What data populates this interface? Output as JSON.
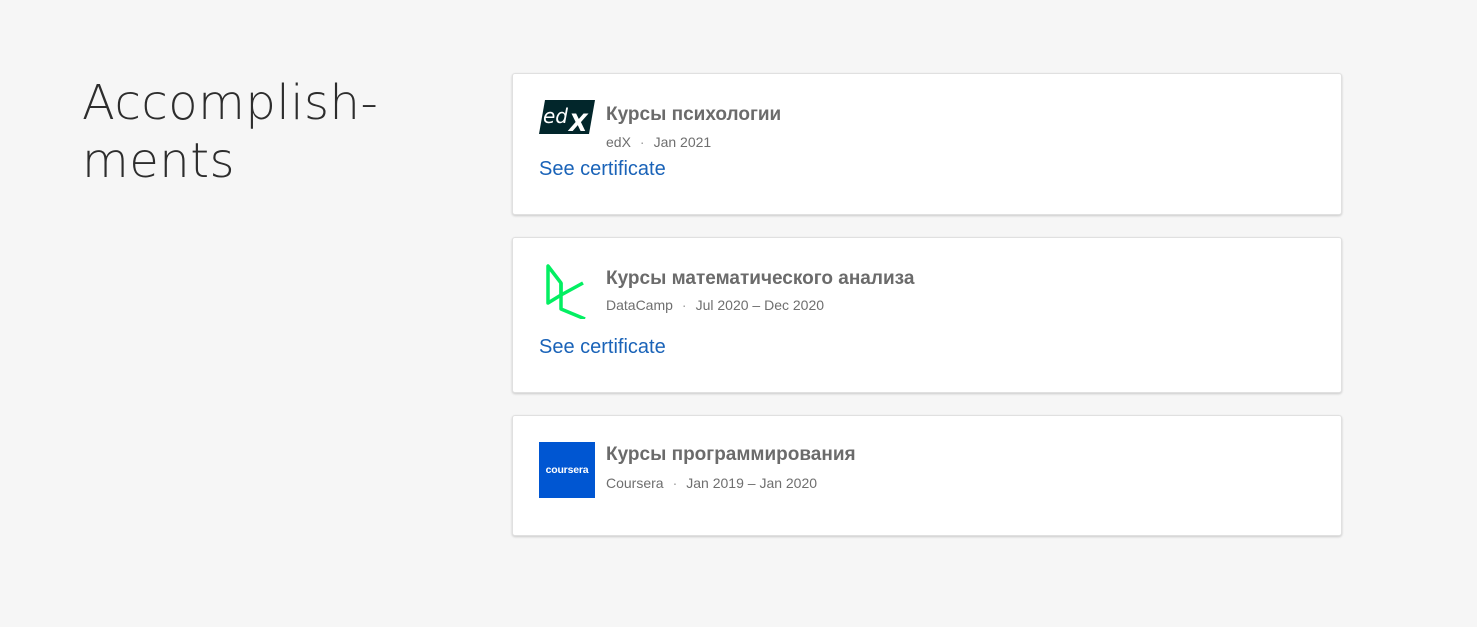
{
  "section": {
    "title_line1": "Accomplish-",
    "title_line2": "ments"
  },
  "accomplishments": [
    {
      "title": "Курсы психологии",
      "provider": "edX",
      "date": "Jan 2021",
      "link_label": "See certificate",
      "logo": "edx-logo"
    },
    {
      "title": "Курсы математического анализа",
      "provider": "DataCamp",
      "date": "Jul 2020 – Dec 2020",
      "link_label": "See certificate",
      "logo": "datacamp-logo"
    },
    {
      "title": "Курсы программирования",
      "provider": "Coursera",
      "date": "Jan 2019 – Jan 2020",
      "logo": "coursera-logo",
      "logo_text": "coursera"
    }
  ],
  "colors": {
    "background": "#f6f6f6",
    "link": "#1a63b8",
    "datacamp_green": "#03ef62",
    "coursera_blue": "#0056d2",
    "edx_dark": "#02262b"
  }
}
